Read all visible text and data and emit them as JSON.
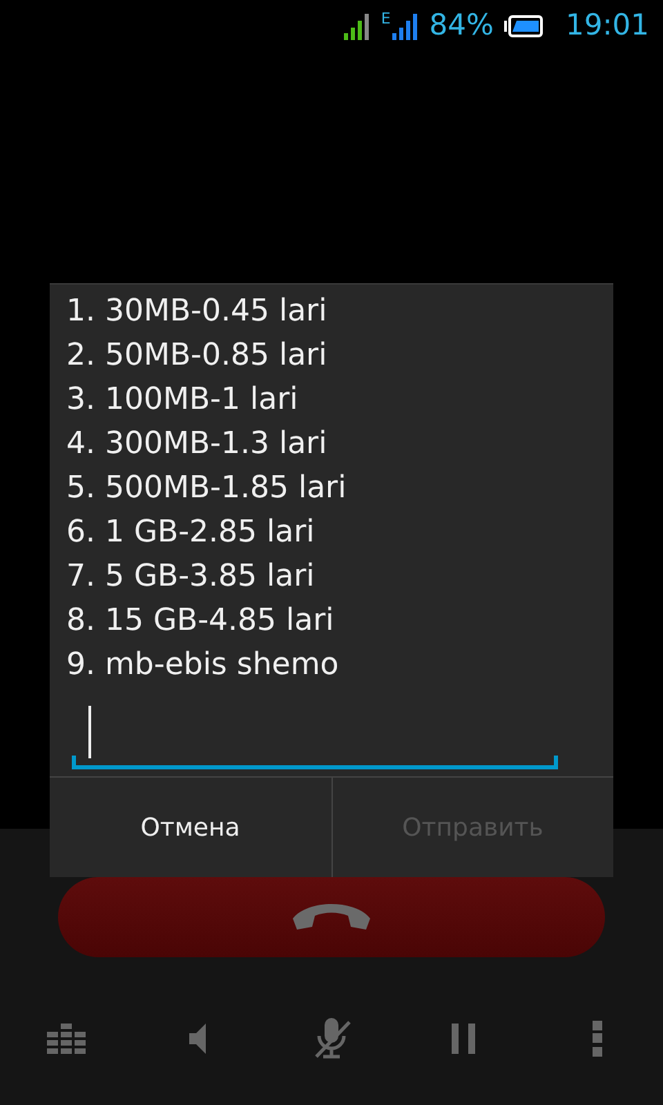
{
  "status_bar": {
    "network_type": "E",
    "battery": "84%",
    "time": "19:01"
  },
  "dialog": {
    "lines": [
      "1. 30MB-0.45 lari",
      "2. 50MB-0.85 lari",
      "3. 100MB-1 lari",
      "4. 300MB-1.3 lari",
      "5. 500MB-1.85 lari",
      "6. 1 GB-2.85 lari",
      "7. 5 GB-3.85 lari",
      "8. 15 GB-4.85 lari",
      "9. mb-ebis shemo"
    ],
    "buttons": [
      {
        "label": "Отмена",
        "disabled": false
      },
      {
        "label": "Отправить",
        "disabled": true
      }
    ]
  }
}
